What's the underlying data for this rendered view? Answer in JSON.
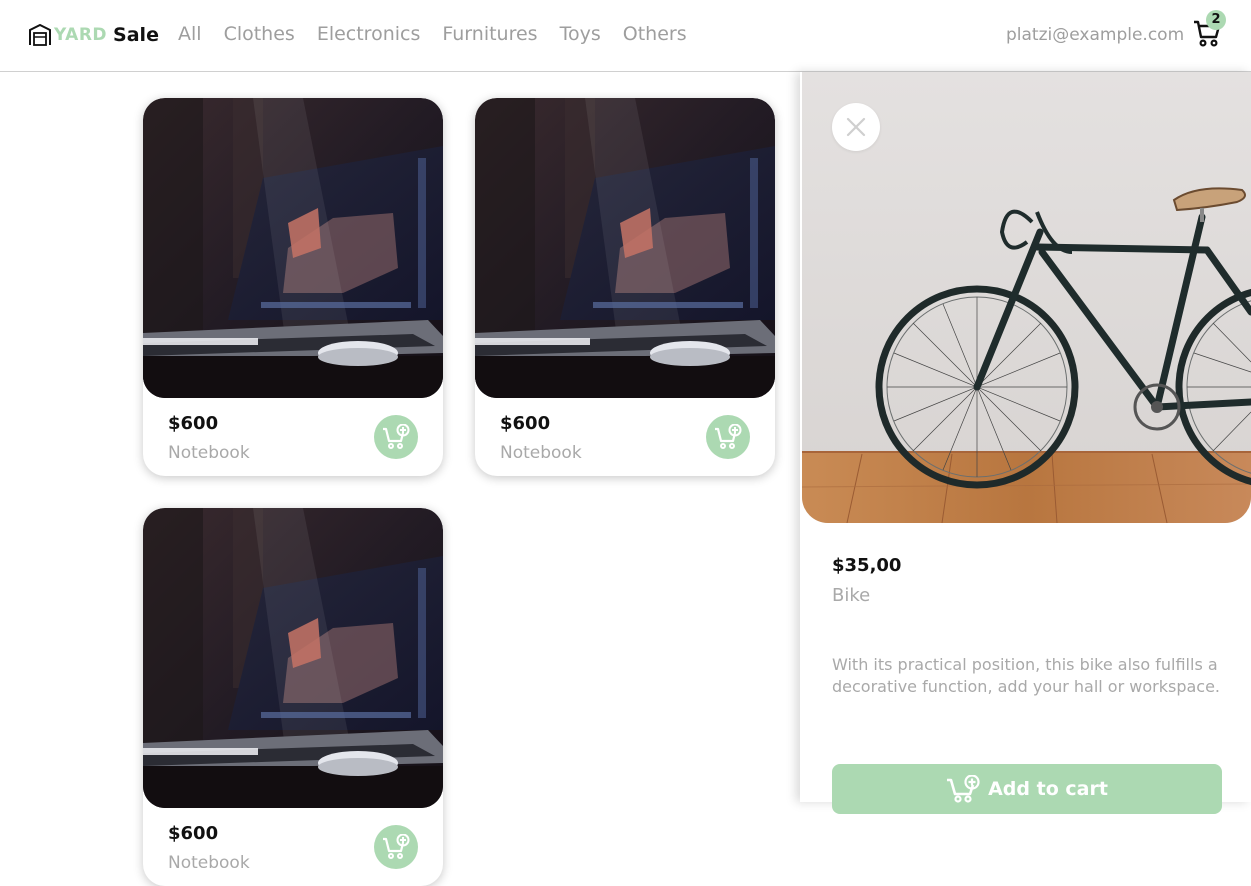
{
  "brand": {
    "part1": "YARD",
    "part2": "Sale"
  },
  "nav": {
    "links": [
      "All",
      "Clothes",
      "Electronics",
      "Furnitures",
      "Toys",
      "Others"
    ]
  },
  "account": {
    "email": "platzi@example.com"
  },
  "cart": {
    "count": "2",
    "icon": "shopping-cart-icon"
  },
  "colors": {
    "accent": "#acd9b2",
    "muted": "#a9a9a9",
    "text": "#111111"
  },
  "products": [
    {
      "price": "$600",
      "name": "Notebook",
      "image": "laptop-photo"
    },
    {
      "price": "$600",
      "name": "Notebook",
      "image": "laptop-photo"
    },
    {
      "price": "$600",
      "name": "Notebook",
      "image": "laptop-photo"
    }
  ],
  "detail": {
    "price": "$35,00",
    "name": "Bike",
    "description": "With its practical position, this bike also fulfills a decorative function, add your hall or workspace.",
    "button": "Add to cart",
    "image": "bike-photo"
  }
}
